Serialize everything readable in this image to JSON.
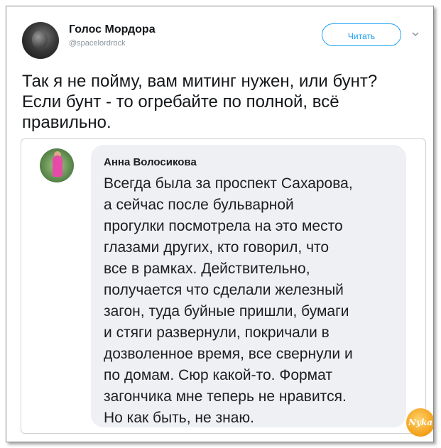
{
  "tweet": {
    "author_name": "Голос Мордора",
    "author_handle": "@spacelordrock",
    "follow_label": "Читать",
    "text": "Так я не пойму, вам митинг нужен, или бунт? Если бунт - то огребайте по полной, всё правильно."
  },
  "quoted_comment": {
    "author_name": "Анна Волосикова",
    "text": "Всегда была за проспект Сахарова,\nа сейчас после бульварной\nпрогулки посмотрела на это место\nглазами других, кто говорил, что\nвсе в рамках. Действительно,\nполучается  что сделали железный\nзагон, туда буйные пришли, бумаги\nи стяги развернули, покричали в\nдозволенное время,  все свернули и\nпо домам. Сюр какой-то. Формат\nзагончика мне теперь не нравится.\nНо как быть, не знаю."
  },
  "watermark": {
    "text": "Nyka"
  },
  "icons": [
    "avatar",
    "chevron-down-icon",
    "watermark-logo"
  ],
  "colors": {
    "accent": "#1da1f2",
    "bubble_bg": "#eef0f4",
    "text": "#14171a"
  }
}
